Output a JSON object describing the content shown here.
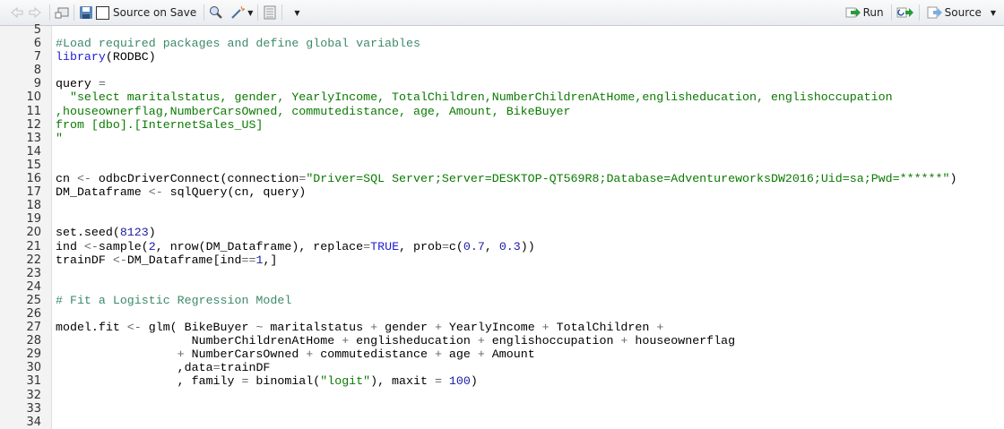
{
  "toolbar": {
    "source_on_save": "Source on Save",
    "run": "Run",
    "source": "Source"
  },
  "editor": {
    "lines": [
      {
        "n": "5",
        "tokens": []
      },
      {
        "n": "6",
        "tokens": [
          [
            "c",
            "#Load required packages and define global variables"
          ]
        ]
      },
      {
        "n": "7",
        "tokens": [
          [
            "k",
            "library"
          ],
          [
            "t",
            "(RODBC)"
          ]
        ]
      },
      {
        "n": "8",
        "tokens": []
      },
      {
        "n": "9",
        "tokens": [
          [
            "t",
            "query "
          ],
          [
            "o",
            "="
          ]
        ]
      },
      {
        "n": "10",
        "tokens": [
          [
            "s",
            "  \"select maritalstatus, gender, YearlyIncome, TotalChildren,NumberChildrenAtHome,englisheducation, englishoccupation"
          ]
        ]
      },
      {
        "n": "11",
        "tokens": [
          [
            "s",
            ",houseownerflag,NumberCarsOwned, commutedistance, age, Amount, BikeBuyer"
          ]
        ]
      },
      {
        "n": "12",
        "tokens": [
          [
            "s",
            "from [dbo].[InternetSales_US]"
          ]
        ]
      },
      {
        "n": "13",
        "tokens": [
          [
            "s",
            "\""
          ]
        ]
      },
      {
        "n": "14",
        "tokens": []
      },
      {
        "n": "15",
        "tokens": []
      },
      {
        "n": "16",
        "tokens": [
          [
            "t",
            "cn "
          ],
          [
            "o",
            "<-"
          ],
          [
            "t",
            " odbcDriverConnect(connection"
          ],
          [
            "o",
            "="
          ],
          [
            "s",
            "\"Driver=SQL Server;Server=DESKTOP-QT569R8;Database=AdventureworksDW2016;Uid=sa;Pwd=******\""
          ],
          [
            "t",
            ")"
          ]
        ]
      },
      {
        "n": "17",
        "tokens": [
          [
            "t",
            "DM_Dataframe "
          ],
          [
            "o",
            "<-"
          ],
          [
            "t",
            " sqlQuery(cn, query)"
          ]
        ]
      },
      {
        "n": "18",
        "tokens": []
      },
      {
        "n": "19",
        "tokens": []
      },
      {
        "n": "20",
        "tokens": [
          [
            "t",
            "set.seed("
          ],
          [
            "n",
            "8123"
          ],
          [
            "t",
            ")"
          ]
        ]
      },
      {
        "n": "21",
        "tokens": [
          [
            "t",
            "ind "
          ],
          [
            "o",
            "<-"
          ],
          [
            "t",
            "sample("
          ],
          [
            "n",
            "2"
          ],
          [
            "t",
            ", nrow(DM_Dataframe), replace"
          ],
          [
            "o",
            "="
          ],
          [
            "k",
            "TRUE"
          ],
          [
            "t",
            ", prob"
          ],
          [
            "o",
            "="
          ],
          [
            "t",
            "c("
          ],
          [
            "n",
            "0.7"
          ],
          [
            "t",
            ", "
          ],
          [
            "n",
            "0.3"
          ],
          [
            "t",
            "))"
          ]
        ]
      },
      {
        "n": "22",
        "tokens": [
          [
            "t",
            "trainDF "
          ],
          [
            "o",
            "<-"
          ],
          [
            "t",
            "DM_Dataframe[ind"
          ],
          [
            "o",
            "=="
          ],
          [
            "n",
            "1"
          ],
          [
            "t",
            ",]"
          ]
        ]
      },
      {
        "n": "23",
        "tokens": []
      },
      {
        "n": "24",
        "tokens": []
      },
      {
        "n": "25",
        "tokens": [
          [
            "c",
            "# Fit a Logistic Regression Model"
          ]
        ]
      },
      {
        "n": "26",
        "tokens": []
      },
      {
        "n": "27",
        "tokens": [
          [
            "t",
            "model.fit "
          ],
          [
            "o",
            "<-"
          ],
          [
            "t",
            " glm( BikeBuyer "
          ],
          [
            "o",
            "~"
          ],
          [
            "t",
            " maritalstatus "
          ],
          [
            "o",
            "+"
          ],
          [
            "t",
            " gender "
          ],
          [
            "o",
            "+"
          ],
          [
            "t",
            " YearlyIncome "
          ],
          [
            "o",
            "+"
          ],
          [
            "t",
            " TotalChildren "
          ],
          [
            "o",
            "+"
          ]
        ]
      },
      {
        "n": "28",
        "tokens": [
          [
            "t",
            "                   NumberChildrenAtHome "
          ],
          [
            "o",
            "+"
          ],
          [
            "t",
            " englisheducation "
          ],
          [
            "o",
            "+"
          ],
          [
            "t",
            " englishoccupation "
          ],
          [
            "o",
            "+"
          ],
          [
            "t",
            " houseownerflag"
          ]
        ]
      },
      {
        "n": "29",
        "tokens": [
          [
            "t",
            "                 "
          ],
          [
            "o",
            "+"
          ],
          [
            "t",
            " NumberCarsOwned "
          ],
          [
            "o",
            "+"
          ],
          [
            "t",
            " commutedistance "
          ],
          [
            "o",
            "+"
          ],
          [
            "t",
            " age "
          ],
          [
            "o",
            "+"
          ],
          [
            "t",
            " Amount"
          ]
        ]
      },
      {
        "n": "30",
        "tokens": [
          [
            "t",
            "                 ,data"
          ],
          [
            "o",
            "="
          ],
          [
            "t",
            "trainDF"
          ]
        ]
      },
      {
        "n": "31",
        "tokens": [
          [
            "t",
            "                 , family "
          ],
          [
            "o",
            "="
          ],
          [
            "t",
            " binomial("
          ],
          [
            "s",
            "\"logit\""
          ],
          [
            "t",
            "), maxit "
          ],
          [
            "o",
            "="
          ],
          [
            "t",
            " "
          ],
          [
            "n",
            "100"
          ],
          [
            "t",
            ")"
          ]
        ]
      },
      {
        "n": "32",
        "tokens": []
      },
      {
        "n": "33",
        "tokens": []
      },
      {
        "n": "34",
        "tokens": []
      }
    ]
  }
}
